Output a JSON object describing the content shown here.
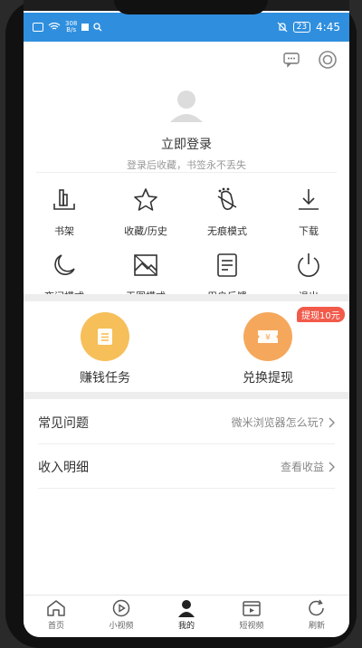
{
  "status_bar": {
    "net_speed_top": "308",
    "net_speed_bottom": "B/s",
    "battery": "23",
    "time": "4:45"
  },
  "login": {
    "title": "立即登录",
    "subtitle": "登录后收藏，书签永不丢失"
  },
  "grid": [
    {
      "label": "书架",
      "icon": "bookshelf-icon"
    },
    {
      "label": "收藏/历史",
      "icon": "star-icon"
    },
    {
      "label": "无痕模式",
      "icon": "no-trace-icon"
    },
    {
      "label": "下载",
      "icon": "download-icon"
    },
    {
      "label": "夜间模式",
      "icon": "moon-icon"
    },
    {
      "label": "无图模式",
      "icon": "no-image-icon"
    },
    {
      "label": "用户反馈",
      "icon": "feedback-icon"
    },
    {
      "label": "退出",
      "icon": "power-icon"
    }
  ],
  "tasks": {
    "earn": {
      "label": "赚钱任务"
    },
    "exchange": {
      "label": "兑换提现",
      "badge": "提现10元"
    }
  },
  "rows": {
    "faq": {
      "title": "常见问题",
      "right": "微米浏览器怎么玩?"
    },
    "income": {
      "title": "收入明细",
      "right": "查看收益"
    }
  },
  "bottom_nav": [
    {
      "label": "首页"
    },
    {
      "label": "小视频"
    },
    {
      "label": "我的"
    },
    {
      "label": "短视频"
    },
    {
      "label": "刷新"
    }
  ],
  "colors": {
    "status_bar": "#2f8fde",
    "task_gold": "#f6bf5a",
    "task_orange": "#f5a85c",
    "badge": "#f25a4a"
  }
}
